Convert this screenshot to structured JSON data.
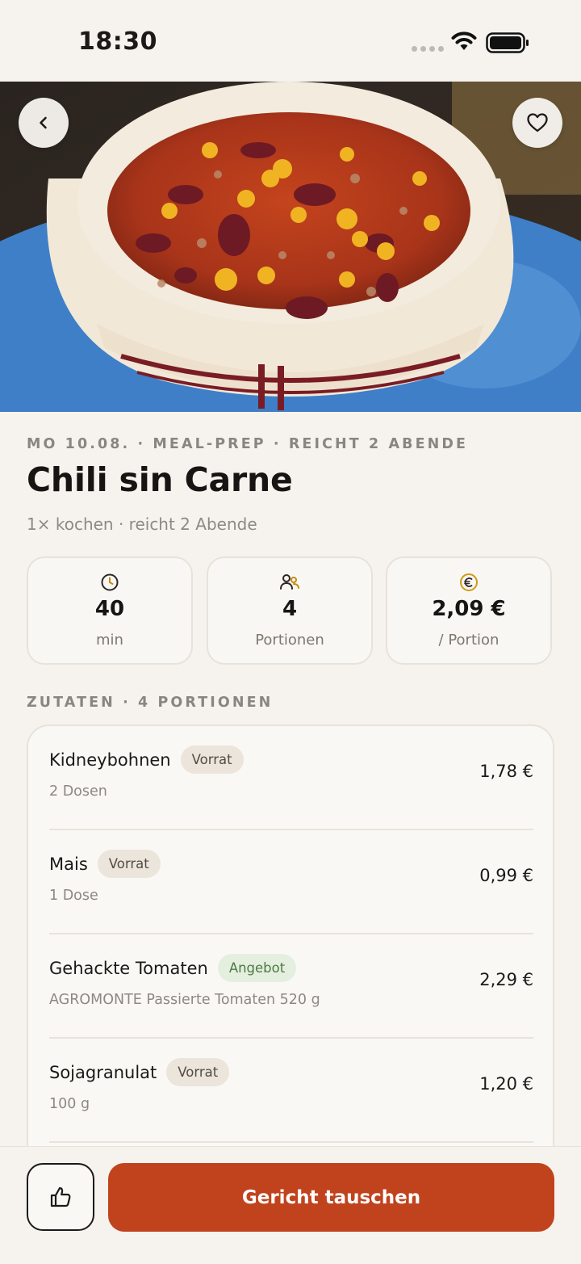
{
  "status_bar": {
    "time": "18:30"
  },
  "hero": {
    "image": "bowl-of-chili-photo"
  },
  "meta": {
    "line": "MO 10.08. · MEAL-PREP · REICHT 2 ABENDE"
  },
  "recipe": {
    "title": "Chili sin Carne",
    "subtitle": "1× kochen · reicht 2 Abende"
  },
  "stats": {
    "time": {
      "icon": "clock-icon",
      "value": "40",
      "label": "min"
    },
    "portions": {
      "icon": "people-icon",
      "value": "4",
      "label": "Portionen"
    },
    "price": {
      "icon": "euro-icon",
      "value": "2,09 €",
      "label": "/ Portion"
    }
  },
  "ingredients": {
    "section_label": "ZUTATEN · 4 PORTIONEN",
    "items": [
      {
        "name": "Kidneybohnen",
        "badge": "Vorrat",
        "amount": "2 Dosen",
        "price": "1,78 €"
      },
      {
        "name": "Mais",
        "badge": "Vorrat",
        "amount": "1 Dose",
        "price": "0,99 €"
      },
      {
        "name": "Gehackte Tomaten",
        "badge": "Angebot",
        "amount": "AGROMONTE Passierte Tomaten 520 g",
        "price": "2,29 €"
      },
      {
        "name": "Sojagranulat",
        "badge": "Vorrat",
        "amount": "100 g",
        "price": "1,20 €"
      }
    ]
  },
  "actions": {
    "swap_label": "Gericht tauschen"
  },
  "colors": {
    "accent": "#c1431e",
    "background": "#f6f3ee",
    "offer_badge": "#e5efdf",
    "stock_badge": "#ebe5dc"
  }
}
